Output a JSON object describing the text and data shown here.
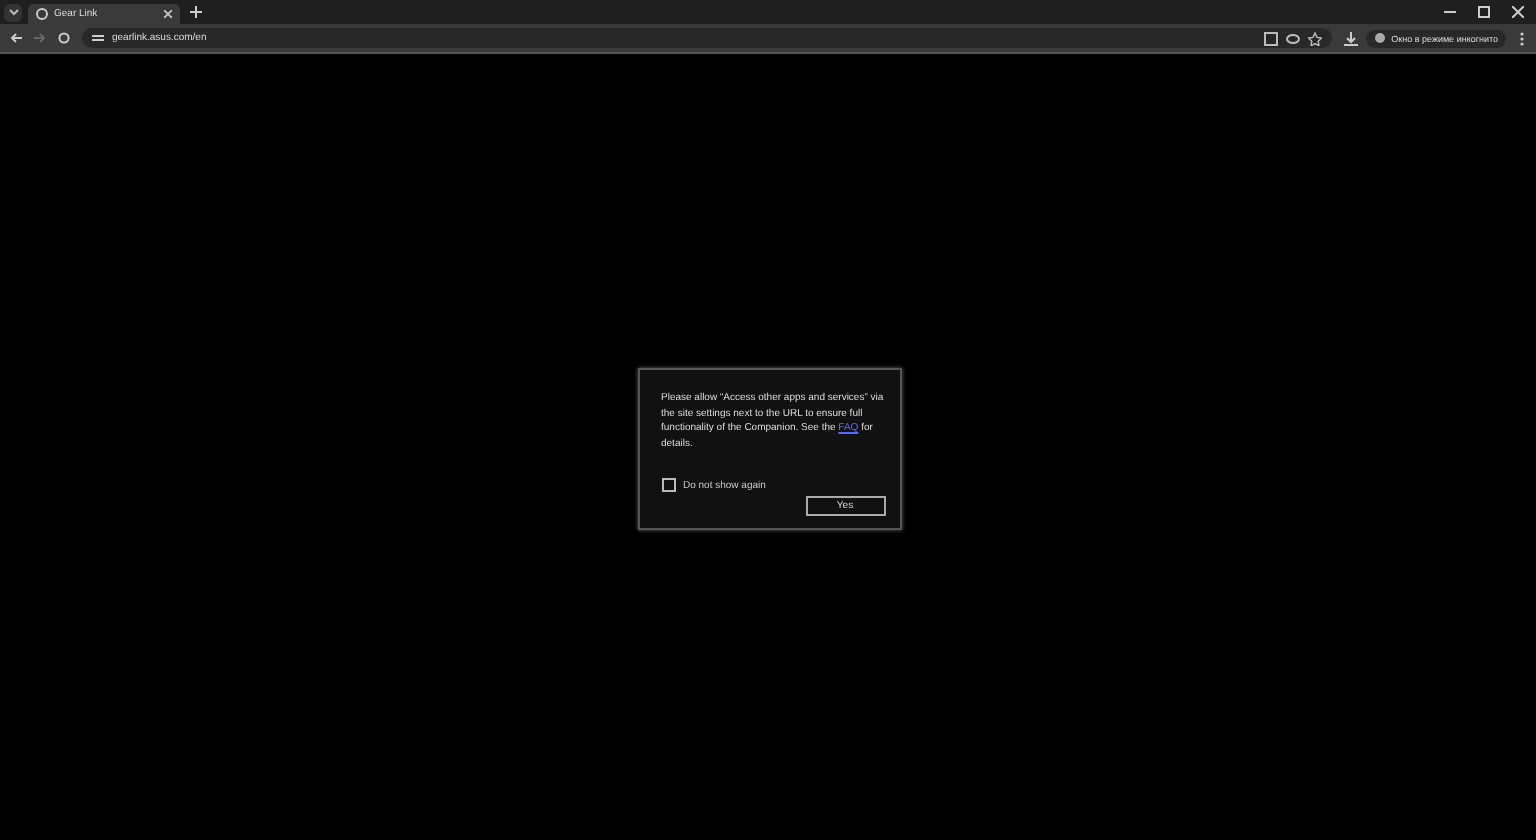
{
  "browser": {
    "tab": {
      "title": "Gear Link",
      "selected": true
    },
    "address": "gearlink.asus.com/en",
    "profile_label": "Окно в режиме инкогнито"
  },
  "dialog": {
    "message_before": "Please allow “Access other apps and services” via the site settings next to the URL to ensure full functionality of the Companion. See the",
    "link": "FAQ",
    "message_after": "for details.",
    "checkbox": {
      "label": "Do not show again",
      "checked": false
    },
    "button": "Yes"
  }
}
